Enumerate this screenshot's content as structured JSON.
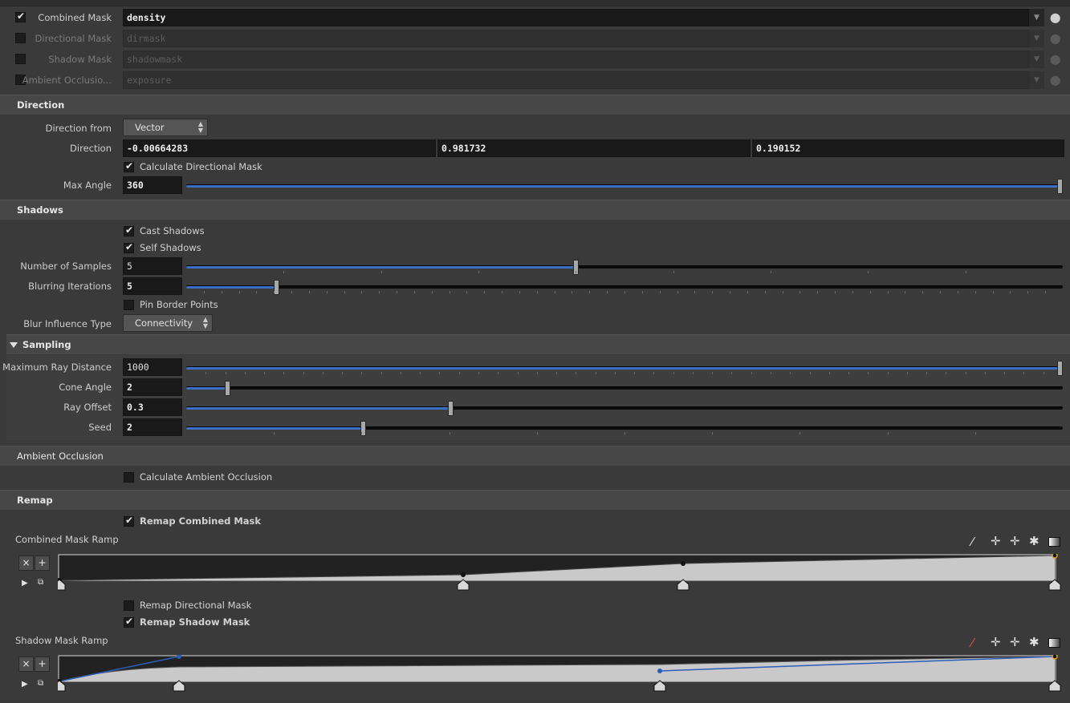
{
  "masks": [
    {
      "label": "Combined Mask",
      "value": "density",
      "checked": true
    },
    {
      "label": "Directional Mask",
      "value": "dirmask",
      "checked": false
    },
    {
      "label": "Shadow Mask",
      "value": "shadowmask",
      "checked": false
    },
    {
      "label": "Ambient Occlusio...",
      "value": "exposure",
      "checked": false
    }
  ],
  "direction": {
    "section": "Direction",
    "direction_from_label": "Direction from",
    "direction_from_value": "Vector",
    "direction_label": "Direction",
    "x": "-0.00664283",
    "y": "0.981732",
    "z": "0.190152",
    "calc_label": "Calculate Directional Mask",
    "max_angle_label": "Max Angle",
    "max_angle": "360",
    "max_angle_fraction": 1.0
  },
  "shadows": {
    "section": "Shadows",
    "cast_label": "Cast Shadows",
    "self_label": "Self Shadows",
    "samples_label": "Number of Samples",
    "samples": "5",
    "samples_fraction": 0.444,
    "blur_label": "Blurring Iterations",
    "blur": "5",
    "blur_fraction": 0.1,
    "pin_label": "Pin Border Points",
    "influence_label": "Blur Influence Type",
    "influence_value": "Connectivity"
  },
  "sampling": {
    "section": "Sampling",
    "max_ray_label": "Maximum Ray Distance",
    "max_ray": "1000",
    "max_ray_fraction": 1.0,
    "cone_label": "Cone Angle",
    "cone": "2",
    "cone_fraction": 0.044,
    "offset_label": "Ray Offset",
    "offset": "0.3",
    "offset_fraction": 0.3,
    "seed_label": "Seed",
    "seed": "2",
    "seed_fraction": 0.2
  },
  "ao": {
    "section": "Ambient Occlusion",
    "calc_label": "Calculate Ambient Occlusion"
  },
  "remap": {
    "section": "Remap",
    "combined_label": "Remap Combined Mask",
    "combined_ramp_label": "Combined Mask Ramp",
    "directional_label": "Remap Directional Mask",
    "shadow_label": "Remap Shadow Mask",
    "shadow_ramp_label": "Shadow Mask Ramp"
  },
  "colors": {
    "accent": "#3a6fc4",
    "key_selected": "#e0a030"
  }
}
